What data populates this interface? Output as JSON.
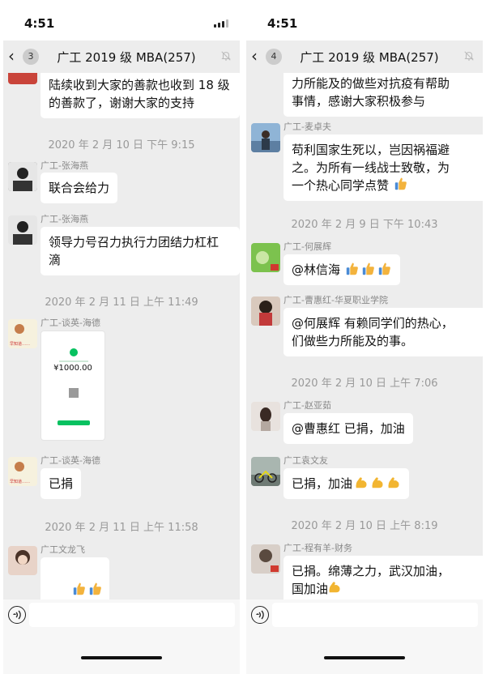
{
  "left": {
    "status_time": "4:51",
    "unread_count": "3",
    "chat_title": "广工 2019 级 MBA(257)",
    "input_placeholder": "",
    "messages": {
      "m1_text": "陆续收到大家的善款也收到 18 级\n的善款了，谢谢大家的支持",
      "ts1": "2020 年 2 月 10 日  下午 9:15",
      "m2_sender": "广工-张海燕",
      "m2_text": "联合会给力",
      "m3_sender": "广工-张海燕",
      "m3_text": "领导力号召力执行力团结力杠杠\n滴",
      "ts2": "2020 年 2 月 11 日  上午 11:49",
      "m4_sender": "广工-谈英-海德",
      "m4_amount": "¥1000.00",
      "m5_sender": "广工-谈英-海德",
      "m5_text": "已捐",
      "ts3": "2020 年 2 月 11 日  上午 11:58",
      "m6_sender": "广工文龙飞"
    }
  },
  "right": {
    "status_time": "4:51",
    "unread_count": "4",
    "chat_title": "广工 2019 级 MBA(257)",
    "messages": {
      "m1_text": "力所能及的做些对抗疫有帮助\n事情，感谢大家积极参与",
      "m2_sender": "广工-麦卓夫",
      "m2_text": "苟利国家生死以，岂因祸福避\n之。为所有一线战士致敬，为\n一个热心同学点赞",
      "ts1": "2020 年 2 月 9 日  下午 10:43",
      "m3_sender": "广工-何展辉",
      "m3_text": "@林信海",
      "m4_sender": "广工-曹惠红-华夏职业学院",
      "m4_text": "@何展辉 有赖同学们的热心，\n们做些力所能及的事。",
      "ts2": "2020 年 2 月 10 日  上午 7:06",
      "m5_sender": "广工-赵亚茹",
      "m5_text": "@曹惠红 已捐，加油",
      "m6_sender": "广工袁文友",
      "m6_text": "已捐，加油",
      "ts3": "2020 年 2 月 10 日  上午 8:19",
      "m7_sender": "广工-程有羊-财务",
      "m7_text": "已捐。绵薄之力，武汉加油，\n国加油"
    }
  },
  "colors": {
    "chat_bg": "#ededed",
    "bubble": "#ffffff",
    "timestamp": "#999999",
    "thumbs_emoji": "#f3b33d",
    "flex_emoji": "#f2b531"
  },
  "icons": [
    "back-chevron-icon",
    "mute-bell-icon",
    "voice-icon",
    "thumbs-up-emoji",
    "flexed-biceps-emoji",
    "signal-icon"
  ]
}
